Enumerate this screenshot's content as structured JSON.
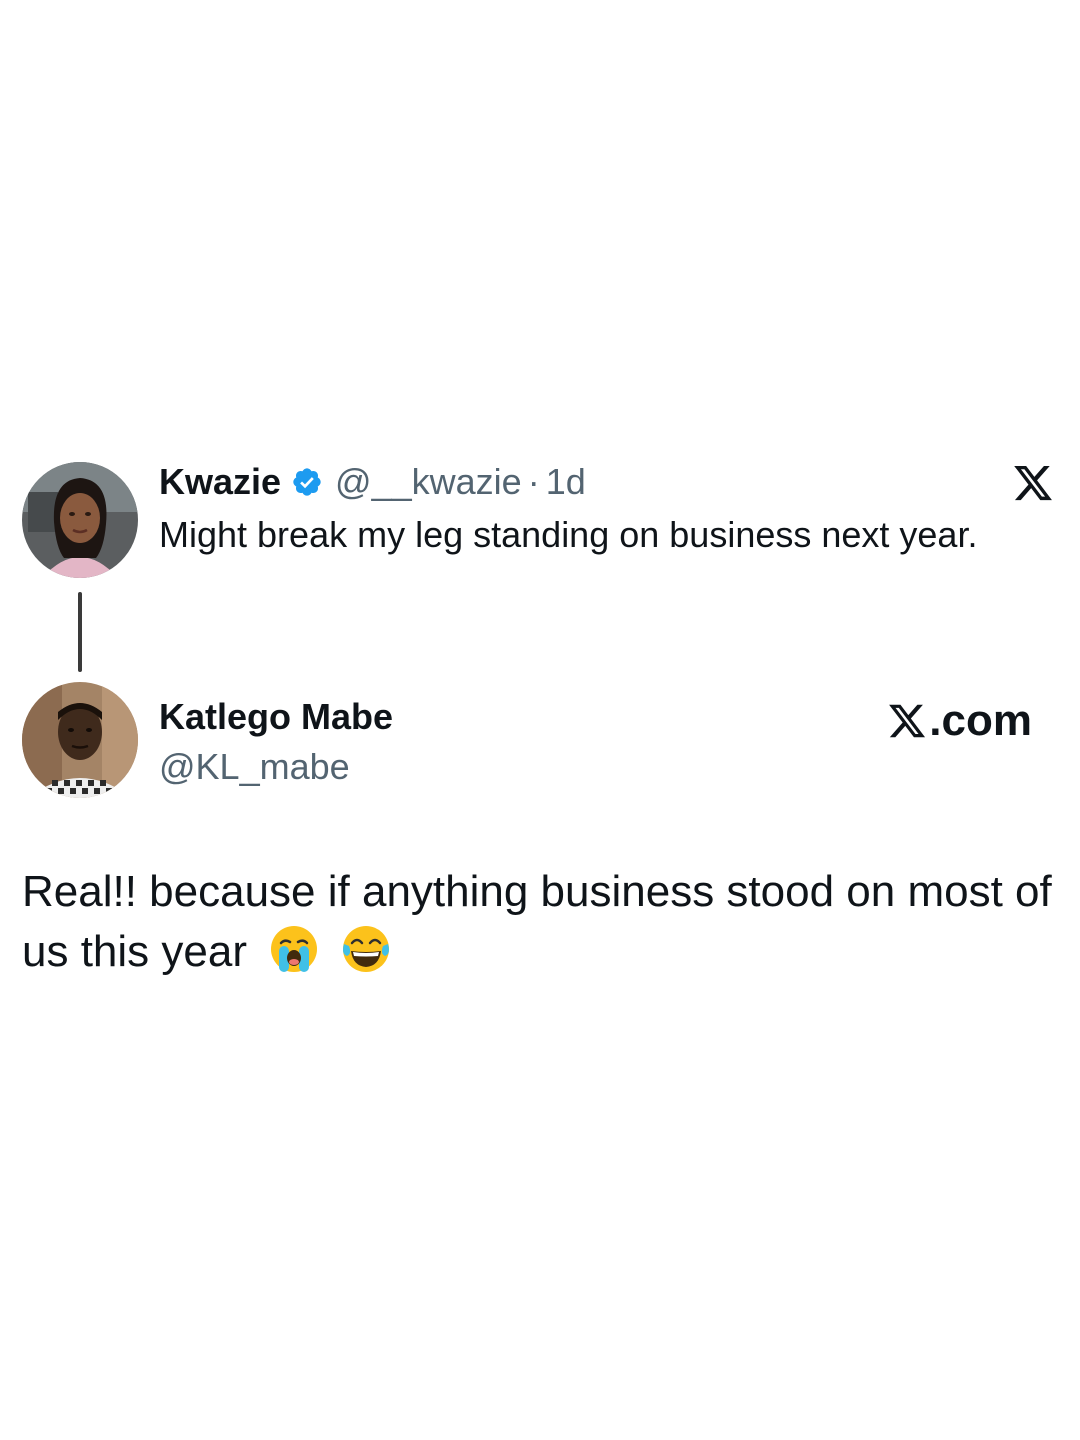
{
  "original_tweet": {
    "display_name": "Kwazie",
    "handle": "@__kwazie",
    "separator": "·",
    "time": "1d",
    "text": "Might break my leg standing on business next year.",
    "verified": true,
    "avatar_icon": "profile-photo-woman",
    "corner_icon": "x-logo-icon"
  },
  "reply": {
    "display_name": "Katlego Mabe",
    "handle": "@KL_mabe",
    "brand_text": ".com",
    "brand_icon": "x-logo-icon",
    "avatar_icon": "profile-photo-man",
    "text": "Real!! because if anything business stood on most of us this year",
    "emojis": [
      "loudly-crying-face",
      "face-with-tears-of-joy"
    ]
  },
  "colors": {
    "text_primary": "#0f1419",
    "text_secondary": "#536471",
    "verified_blue": "#1d9bf0",
    "thread_line": "#3a3a3a",
    "background": "#ffffff"
  }
}
